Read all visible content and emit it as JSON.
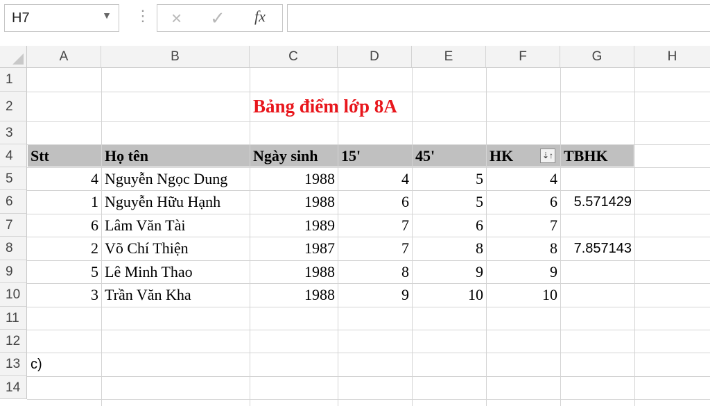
{
  "formula_bar": {
    "name_box": "H7",
    "cancel_icon": "×",
    "enter_icon": "✓",
    "fx_label": "fx",
    "formula": ""
  },
  "columns": [
    "A",
    "B",
    "C",
    "D",
    "E",
    "F",
    "G",
    "H"
  ],
  "rows": [
    "1",
    "2",
    "3",
    "4",
    "5",
    "6",
    "7",
    "8",
    "9",
    "10",
    "11",
    "12",
    "13",
    "14"
  ],
  "sheet": {
    "title": "Bảng điểm lớp 8A",
    "headers": [
      "Stt",
      "Họ tên",
      "Ngày sinh",
      "15'",
      "45'",
      "HK",
      "TBHK"
    ],
    "data": [
      [
        "4",
        "Nguyễn Ngọc Dung",
        "1988",
        "4",
        "5",
        "4",
        ""
      ],
      [
        "1",
        "Nguyễn Hữu Hạnh",
        "1988",
        "6",
        "5",
        "6",
        "5.571429"
      ],
      [
        "6",
        "Lâm Văn Tài",
        "1989",
        "7",
        "6",
        "7",
        ""
      ],
      [
        "2",
        "Võ Chí Thiện",
        "1987",
        "7",
        "8",
        "8",
        "7.857143"
      ],
      [
        "5",
        "Lê Minh Thao",
        "1988",
        "8",
        "9",
        "9",
        ""
      ],
      [
        "3",
        "Trần Văn Kha",
        "1988",
        "9",
        "10",
        "10",
        ""
      ]
    ],
    "note": "c)"
  },
  "colors": {
    "title": "#e8161c",
    "header_fill": "#c0c0c0",
    "headers_bg": "#f3f3f3",
    "gridline": "#d4d4d4"
  }
}
